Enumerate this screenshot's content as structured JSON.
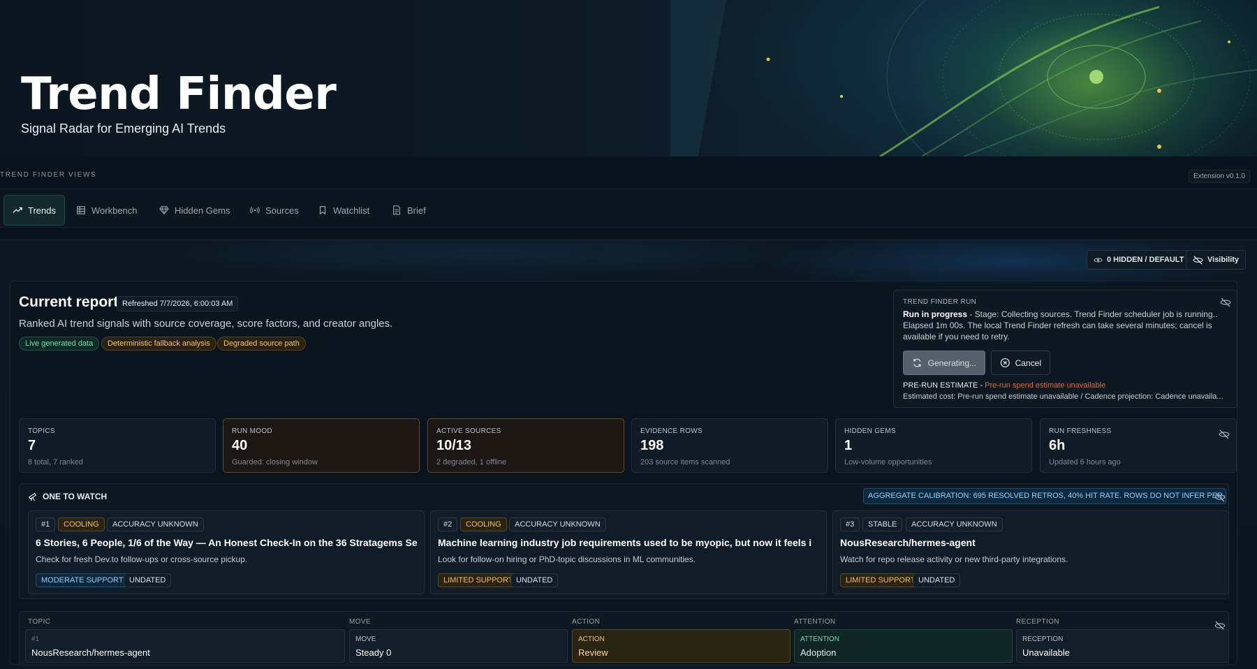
{
  "hero": {
    "title": "Trend Finder",
    "subtitle": "Signal Radar for Emerging AI Trends"
  },
  "nav": {
    "section_label": "TREND FINDER VIEWS",
    "extension_version": "Extension v0.1.0",
    "tabs": [
      {
        "label": "Trends",
        "icon": "trend-up-icon",
        "active": true
      },
      {
        "label": "Workbench",
        "icon": "table-icon",
        "active": false
      },
      {
        "label": "Hidden Gems",
        "icon": "gem-icon",
        "active": false
      },
      {
        "label": "Sources",
        "icon": "broadcast-icon",
        "active": false
      },
      {
        "label": "Watchlist",
        "icon": "bookmark-icon",
        "active": false
      },
      {
        "label": "Brief",
        "icon": "document-icon",
        "active": false
      }
    ]
  },
  "visibility": {
    "hidden_count_label": "0 HIDDEN / DEFAULT",
    "toggle_label": "Visibility"
  },
  "report": {
    "title": "Current report",
    "refreshed": "Refreshed 7/7/2026, 6:00:03 AM",
    "description": "Ranked AI trend signals with source coverage, score factors, and creator angles.",
    "badges": [
      "Live generated data",
      "Deterministic fallback analysis",
      "Degraded source path"
    ]
  },
  "run": {
    "header": "TREND FINDER RUN",
    "status_strong": "Run in progress",
    "status_text": " - Stage: Collecting sources. Trend Finder scheduler job is running.. Elapsed 1m 00s. The local Trend Finder refresh can take several minutes; cancel is available if you need to retry.",
    "generate_label": "Generating...",
    "cancel_label": "Cancel",
    "estimate_label": "PRE-RUN ESTIMATE - ",
    "estimate_warning": "Pre-run spend estimate unavailable",
    "estimated_cost": "Estimated cost: Pre-run spend estimate unavailable / Cadence projection: Cadence unavaila..."
  },
  "stats": [
    {
      "label": "TOPICS",
      "value": "7",
      "sub": "8 total, 7 ranked"
    },
    {
      "label": "RUN MOOD",
      "value": "40",
      "sub": "Guarded: closing window"
    },
    {
      "label": "ACTIVE SOURCES",
      "value": "10/13",
      "sub": "2 degraded, 1 offline"
    },
    {
      "label": "EVIDENCE ROWS",
      "value": "198",
      "sub": "203 source items scanned"
    },
    {
      "label": "HIDDEN GEMS",
      "value": "1",
      "sub": "Low-volume opportunities"
    },
    {
      "label": "RUN FRESHNESS",
      "value": "6h",
      "sub": "Updated 6 hours ago"
    }
  ],
  "one_to_watch": {
    "title": "ONE TO WATCH",
    "calibration": "AGGREGATE CALIBRATION: 695 RESOLVED RETROS, 40% HIT RATE. ROWS DO NOT INFER PER-ROW ACCURACY.",
    "items": [
      {
        "rank": "#1",
        "status": "COOLING",
        "accuracy": "ACCURACY UNKNOWN",
        "title": "6 Stories, 6 People, 1/6 of the Way — An Honest Check-In on the 36 Stratagems Se",
        "desc": "Check for fresh Dev.to follow-ups or cross-source pickup.",
        "support": "MODERATE SUPPORT",
        "date": "UNDATED"
      },
      {
        "rank": "#2",
        "status": "COOLING",
        "accuracy": "ACCURACY UNKNOWN",
        "title": "Machine learning industry job requirements used to be myopic, but now it feels i",
        "desc": "Look for follow-on hiring or PhD-topic discussions in ML communities.",
        "support": "LIMITED SUPPORT",
        "date": "UNDATED"
      },
      {
        "rank": "#3",
        "status": "STABLE",
        "accuracy": "ACCURACY UNKNOWN",
        "title": "NousResearch/hermes-agent",
        "desc": "Watch for repo release activity or new third-party integrations.",
        "support": "LIMITED SUPPORT",
        "date": "UNDATED"
      }
    ]
  },
  "table": {
    "headers": [
      "TOPIC",
      "MOVE",
      "ACTION",
      "ATTENTION",
      "RECEPTION"
    ],
    "row": {
      "rank": "#1",
      "topic": "NousResearch/hermes-agent",
      "move_label": "MOVE",
      "move": "Steady 0",
      "action_label": "ACTION",
      "action": "Review",
      "attention_label": "ATTENTION",
      "attention": "Adoption",
      "reception_label": "RECEPTION",
      "reception": "Unavailable"
    }
  }
}
